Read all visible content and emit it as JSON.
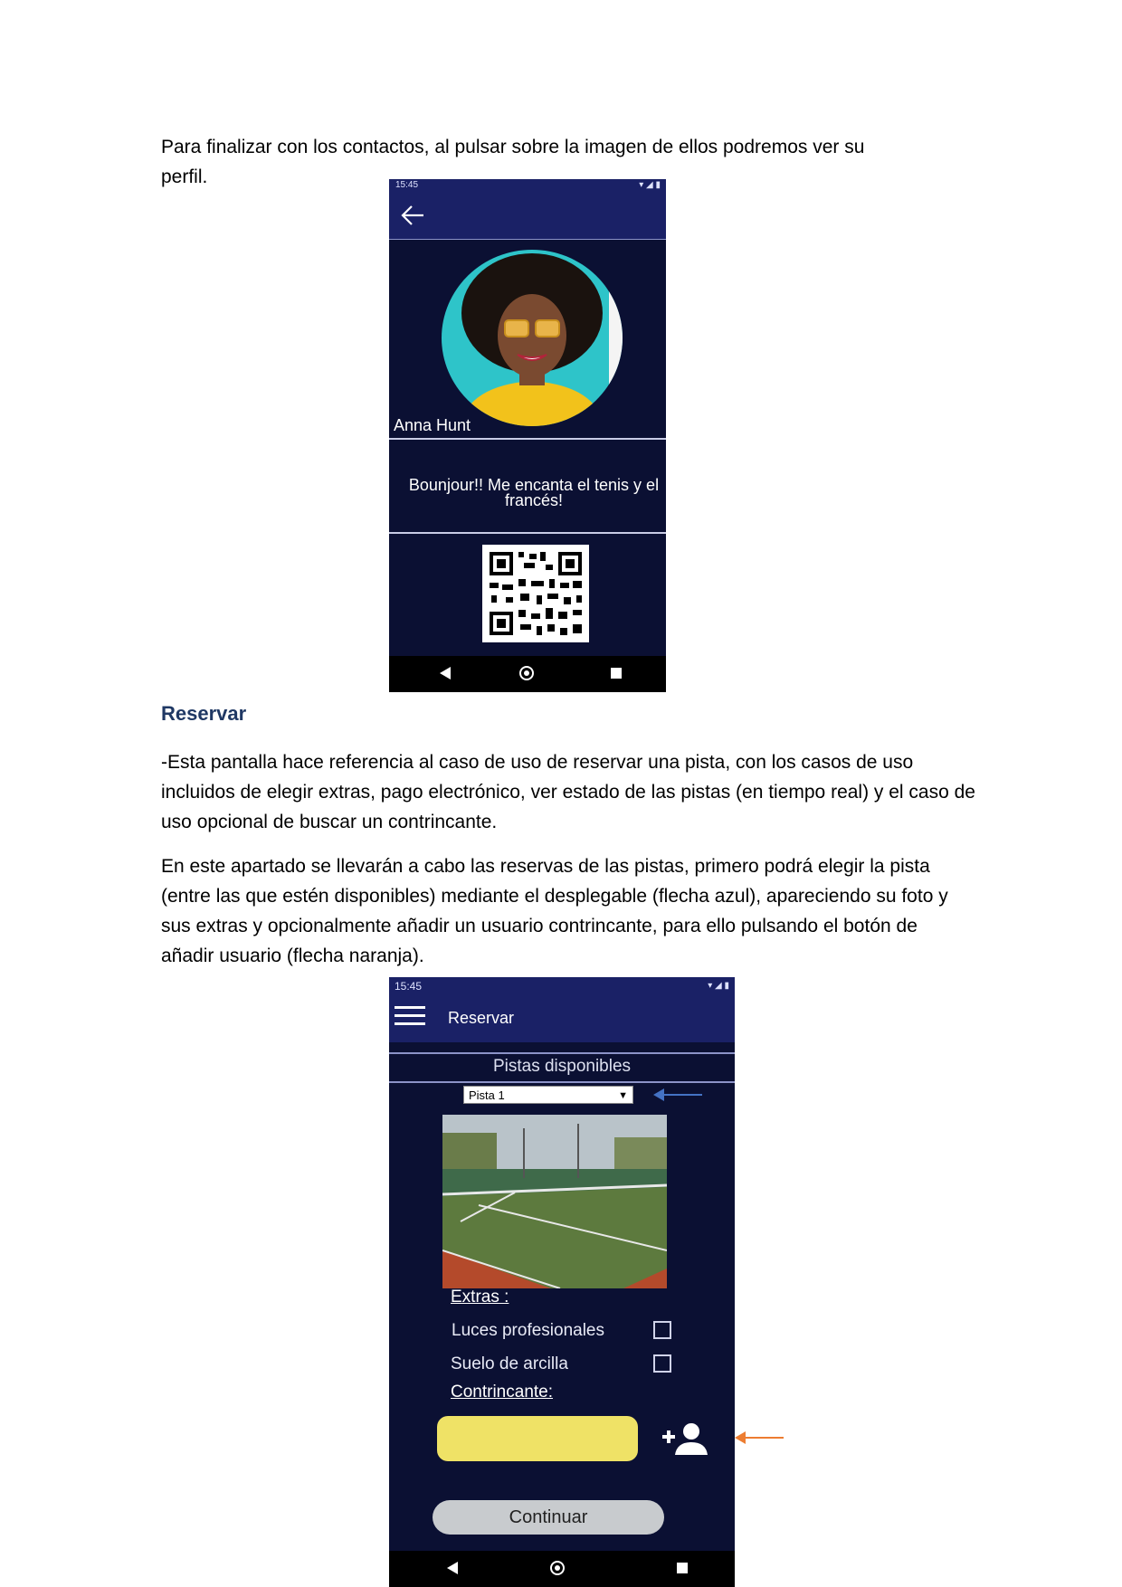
{
  "doc": {
    "intro_line1": "Para finalizar con los contactos, al pulsar sobre la imagen de ellos podremos ver su",
    "intro_line2": "perfil.",
    "section_heading": "Reservar",
    "para1": "-Esta pantalla hace referencia al caso de uso de reservar una pista, con los casos de uso incluidos de elegir extras, pago electrónico, ver estado de las pistas (en tiempo real) y el caso de uso opcional de buscar un contrincante.",
    "para2": "En este apartado se llevarán a cabo las reservas de las pistas, primero podrá elegir la pista (entre las que estén disponibles) mediante el desplegable (flecha azul), apareciendo su foto y sus extras y opcionalmente añadir un usuario contrincante, para ello pulsando el botón de añadir usuario (flecha naranja)."
  },
  "profile_screen": {
    "status_time": "15:45",
    "status_icons": "▾ ◢ ▮",
    "name": "Anna Hunt",
    "bio": "Bounjour!! Me encanta el tenis y el francés!",
    "icons": [
      "back-arrow-icon",
      "qr-code-icon",
      "nav-back-icon",
      "nav-home-icon",
      "nav-recent-icon"
    ]
  },
  "reserve_screen": {
    "status_time": "15:45",
    "status_icons": "▾ ◢ ▮",
    "title": "Reservar",
    "pistas_label": "Pistas disponibles",
    "selected_pista": "Pista 1",
    "extras_label": "Extras :",
    "extras": [
      {
        "label": "Luces profesionales",
        "checked": false
      },
      {
        "label": "Suelo de arcilla",
        "checked": false
      }
    ],
    "opponent_label": "Contrincante:",
    "opponent_value": "",
    "continue_label": "Continuar",
    "icons": [
      "hamburger-menu-icon",
      "add-user-icon",
      "nav-back-icon",
      "nav-home-icon",
      "nav-recent-icon"
    ]
  },
  "annotations": {
    "dropdown_arrow_color": "#4472c4",
    "add_user_arrow_color": "#ed7d31"
  },
  "colors": {
    "screen_bg": "#0b1033",
    "appbar_bg": "#1a2166",
    "heading_color": "#1f3864",
    "opponent_field": "#efe266"
  }
}
